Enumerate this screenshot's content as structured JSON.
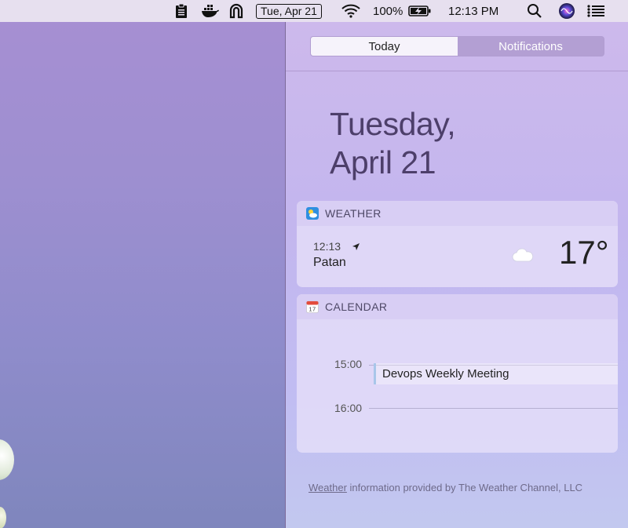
{
  "menubar": {
    "date": "Tue, Apr 21",
    "battery": "100%",
    "time": "12:13 PM",
    "icons": [
      "clipboard-icon",
      "docker-icon",
      "magnet-icon",
      "wifi-icon",
      "battery-charging-icon",
      "spotlight-search-icon",
      "siri-icon",
      "notification-center-icon"
    ]
  },
  "notification_center": {
    "tabs": [
      {
        "label": "Today",
        "selected": true
      },
      {
        "label": "Notifications",
        "selected": false
      }
    ],
    "date_line1": "Tuesday,",
    "date_line2": "April 21"
  },
  "weather": {
    "title": "WEATHER",
    "time": "12:13",
    "city": "Patan",
    "temperature": "17°",
    "condition_icon": "cloud-icon"
  },
  "calendar": {
    "title": "CALENDAR",
    "times": [
      "15:00",
      "16:00"
    ],
    "event": "Devops Weekly Meeting"
  },
  "footer": {
    "link": "Weather",
    "text": "information provided by The Weather Channel, LLC"
  },
  "colors": {
    "desktop": "#9d8fd0",
    "panel": "#c3b6ee",
    "segment_selected": "#f6f3fb",
    "segment_unselected": "#b39fd3"
  }
}
